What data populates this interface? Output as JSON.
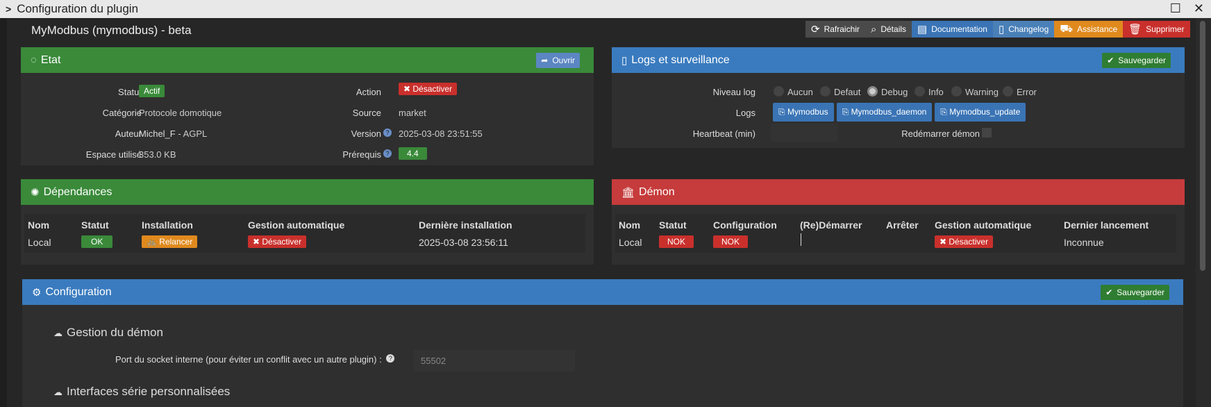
{
  "window": {
    "title": "Configuration du plugin"
  },
  "plugin_title": "MyModbus (mymodbus) - beta",
  "toolbar": {
    "refresh": "Rafraichir",
    "details": "Détails",
    "documentation": "Documentation",
    "changelog": "Changelog",
    "assistance": "Assistance",
    "delete": "Supprimer"
  },
  "etat": {
    "title": "Etat",
    "open_btn": "Ouvrir",
    "statut_label": "Statut",
    "statut_value": "Actif",
    "categorie_label": "Catégorie",
    "categorie_value": "Protocole domotique",
    "auteur_label": "Auteur",
    "auteur_value": "Michel_F",
    "licence_value": " - AGPL",
    "espace_label": "Espace utilisé",
    "espace_value": "353.0 KB",
    "action_label": "Action",
    "action_value": "Désactiver",
    "source_label": "Source",
    "source_value": "market",
    "version_label": "Version",
    "version_value": "2025-03-08 23:51:55",
    "prerequis_label": "Prérequis",
    "prerequis_value": "4.4"
  },
  "logs": {
    "title": "Logs et surveillance",
    "save_btn": "Sauvegarder",
    "niveau_label": "Niveau log",
    "levels": [
      "Aucun",
      "Defaut",
      "Debug",
      "Info",
      "Warning",
      "Error"
    ],
    "selected_level": "Debug",
    "logs_label": "Logs",
    "log_buttons": [
      "Mymodbus",
      "Mymodbus_daemon",
      "Mymodbus_update"
    ],
    "heartbeat_label": "Heartbeat (min)",
    "heartbeat_value": "",
    "restart_label": "Redémarrer démon"
  },
  "dependances": {
    "title": "Dépendances",
    "headers": [
      "Nom",
      "Statut",
      "Installation",
      "Gestion automatique",
      "Dernière installation"
    ],
    "row": {
      "nom": "Local",
      "statut": "OK",
      "installation": "Relancer",
      "gestion": "Désactiver",
      "derniere": "2025-03-08 23:56:11"
    }
  },
  "demon": {
    "title": "Démon",
    "headers": [
      "Nom",
      "Statut",
      "Configuration",
      "(Re)Démarrer",
      "Arrêter",
      "Gestion automatique",
      "Dernier lancement"
    ],
    "row": {
      "nom": "Local",
      "statut": "NOK",
      "configuration": "NOK",
      "gestion": "Désactiver",
      "dernier": "Inconnue"
    }
  },
  "configuration": {
    "title": "Configuration",
    "save_btn": "Sauvegarder",
    "section1": "Gestion du démon",
    "port_label": "Port du socket interne (pour éviter un conflit avec un autre plugin) :",
    "port_placeholder": "55502",
    "section2": "Interfaces série personnalisées"
  }
}
